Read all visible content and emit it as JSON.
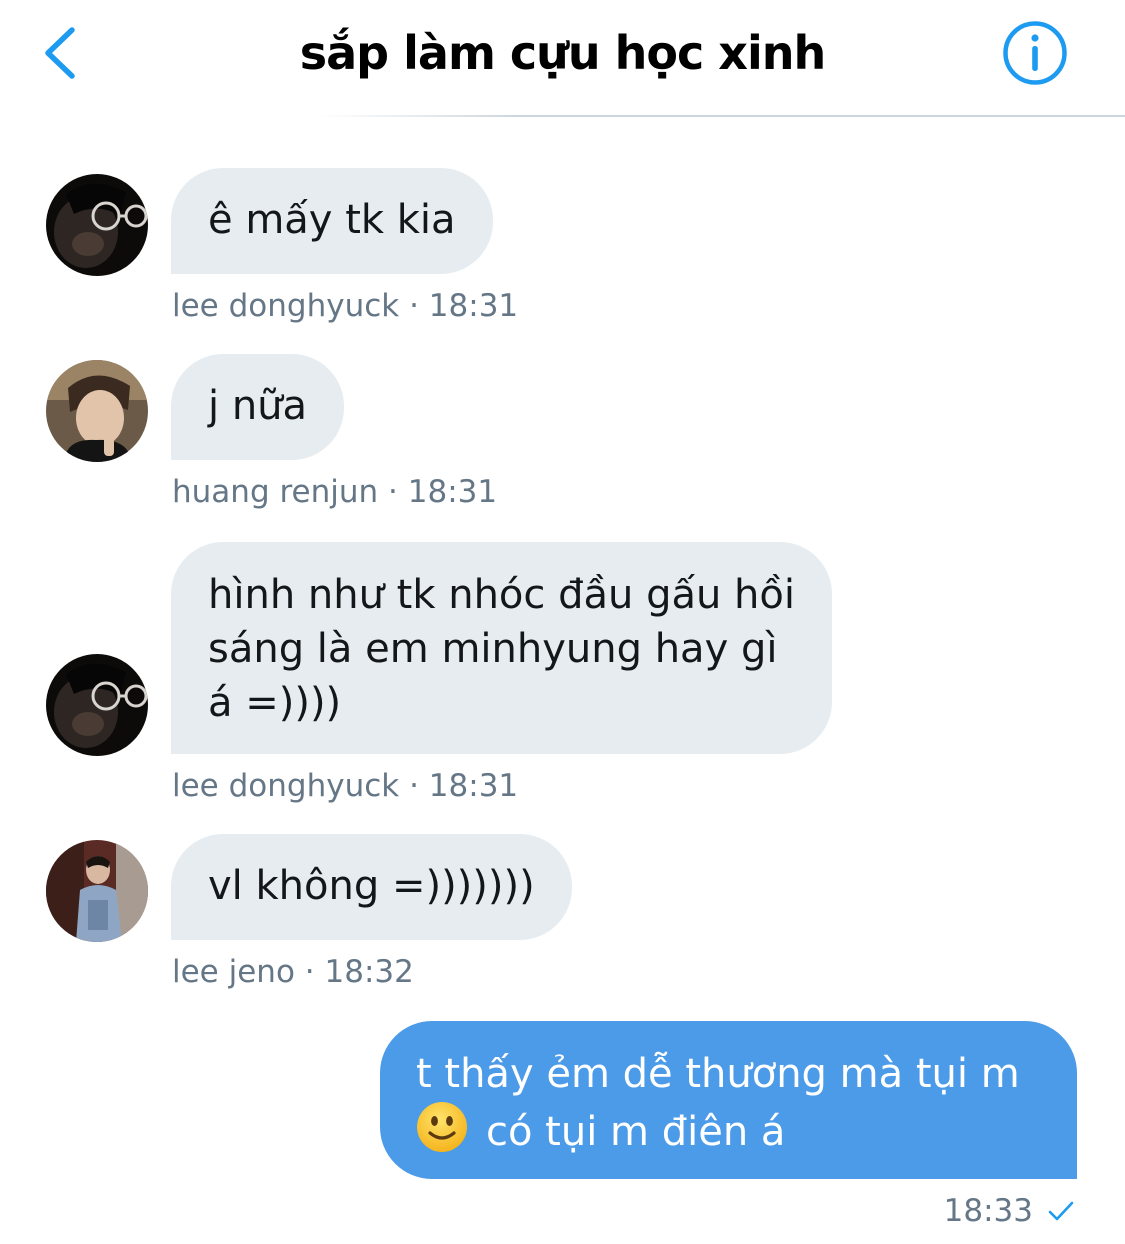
{
  "header": {
    "title": "sắp làm cựu học xinh",
    "back_icon": "chevron-left-icon",
    "info_icon": "info-circle-icon"
  },
  "colors": {
    "accent": "#1d9bf0",
    "incoming_bubble": "#e6ecf0",
    "outgoing_bubble": "#4c9be8",
    "meta_text": "#657786"
  },
  "messages": [
    {
      "direction": "incoming",
      "text_lines": [
        "ê mấy tk kia"
      ],
      "sender": "lee donghyuck",
      "time": "18:31"
    },
    {
      "direction": "incoming",
      "text_lines": [
        "j nữa"
      ],
      "sender": "huang renjun",
      "time": "18:31"
    },
    {
      "direction": "incoming",
      "text_lines": [
        "hình như tk nhóc đầu gấu hồi",
        "sáng là em minhyung hay gì",
        "á =))))"
      ],
      "sender": "lee donghyuck",
      "time": "18:31"
    },
    {
      "direction": "incoming",
      "text_lines": [
        "vl không =)))))))"
      ],
      "sender": "lee jeno",
      "time": "18:32"
    },
    {
      "direction": "outgoing",
      "text_lines": [
        "t thấy ẻm dễ thương mà tụi m",
        "có tụi m điên á"
      ],
      "emoji": "slightly-smiling-face-icon",
      "time": "18:33",
      "status_icon": "checkmark-icon"
    }
  ],
  "meta_separator": "·"
}
